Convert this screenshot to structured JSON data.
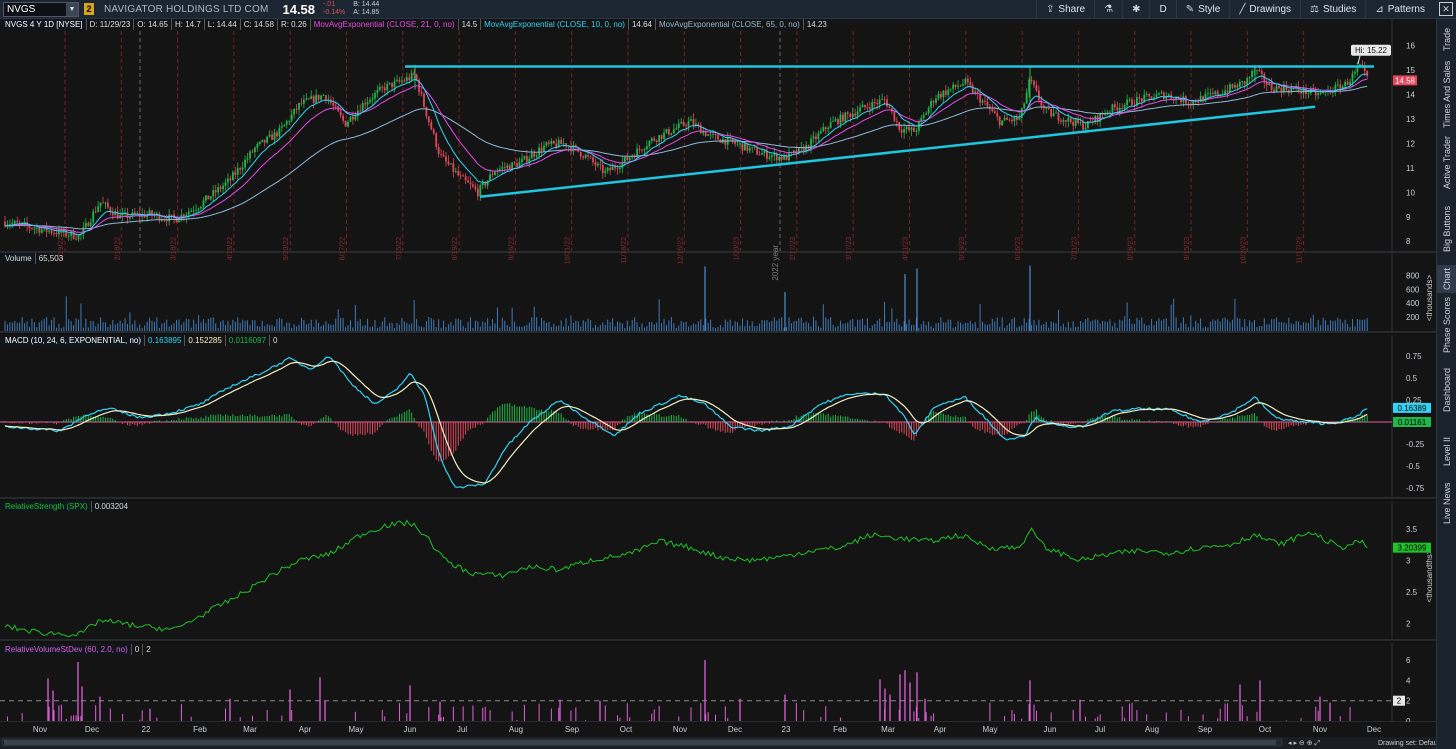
{
  "toolbar": {
    "symbol": "NVGS",
    "link_badge": "2",
    "company": "NAVIGATOR HOLDINGS LTD COM",
    "last": "14.58",
    "change": "-.01",
    "change_pct": "-0.14%",
    "bid": "B: 14.44",
    "ask": "A: 14.85",
    "buttons": [
      {
        "label": "Share",
        "icon": "share-icon"
      },
      {
        "label": "",
        "icon": "flask-icon"
      },
      {
        "label": "",
        "icon": "gear-icon"
      },
      {
        "label": "D",
        "icon": ""
      },
      {
        "label": "Style",
        "icon": "pen-icon"
      },
      {
        "label": "Drawings",
        "icon": "drawing-icon"
      },
      {
        "label": "Studies",
        "icon": "studies-icon"
      },
      {
        "label": "Patterns",
        "icon": "patterns-icon"
      }
    ]
  },
  "side_tabs": [
    "Trade",
    "Times And Sales",
    "Active Trader",
    "Big Buttons",
    "Chart",
    "Phase Scores",
    "Dashboard",
    "Level II",
    "Live News"
  ],
  "price_panel": {
    "header": [
      "NVGS 4 Y 1D [NYSE]",
      "D: 11/29/23",
      "O: 14.65",
      "H: 14.7",
      "L: 14.44",
      "C: 14.58",
      "R: 0.26"
    ],
    "studies": [
      {
        "label": "MovAvgExponential (CLOSE, 21, 0, no)",
        "value": "14.5",
        "color": "#e34de8"
      },
      {
        "label": "MovAvgExponential (CLOSE, 10, 0, no)",
        "value": "14.64",
        "color": "#31d4f5"
      },
      {
        "label": "MovAvgExponential (CLOSE, 65, 0, no)",
        "value": "14.23",
        "color": "#8fb8d8"
      }
    ],
    "hi_label": "Hi: 15.22",
    "last_label": "14.58",
    "y_ticks": [
      "16",
      "15",
      "14",
      "13",
      "12",
      "11",
      "10",
      "9",
      "8"
    ],
    "date_labels": [
      "1/19/22",
      "2/18/22",
      "3/18/22",
      "4/15/22",
      "5/20/22",
      "6/17/22",
      "7/15/22",
      "8/19/22",
      "9/16/22",
      "10/21/22",
      "11/18/22",
      "12/16/22",
      "1/20/23",
      "2/17/23",
      "3/17/23",
      "4/21/23",
      "5/19/23",
      "6/16/23",
      "7/21/23",
      "8/18/23",
      "9/15/23",
      "10/20/23",
      "11/17/23"
    ],
    "year_labels": [
      "2022 year"
    ]
  },
  "volume_panel": {
    "header": [
      "Volume",
      "65,503"
    ],
    "y_ticks": [
      "800",
      "600",
      "400",
      "200"
    ],
    "unit": "<thousands>"
  },
  "macd_panel": {
    "header": [
      "MACD (10, 24, 6, EXPONENTIAL, no)",
      "0.163895",
      "0.152285",
      "0.0116097",
      "0"
    ],
    "y_ticks": [
      "0.75",
      "0.5",
      "0.25",
      "-0.25",
      "-0.5",
      "-0.75"
    ],
    "value_label": "0.16389",
    "diff_label": "0.01161"
  },
  "rs_panel": {
    "header": [
      "RelativeStrength (SPX)",
      "0.003204"
    ],
    "y_ticks": [
      "3.5",
      "3",
      "2.5",
      "2"
    ],
    "value_label": "3.20399",
    "unit": "<thousandths>"
  },
  "rv_panel": {
    "header": [
      "RelativeVolumeStDev (60, 2.0, no)",
      "0",
      "2"
    ],
    "y_ticks": [
      "6",
      "4",
      "2",
      "0"
    ],
    "value_label": "2"
  },
  "x_axis": {
    "labels": [
      "Nov",
      "Dec",
      "22",
      "Feb",
      "Mar",
      "Apr",
      "May",
      "Jun",
      "Jul",
      "Aug",
      "Sep",
      "Oct",
      "Nov",
      "Dec",
      "23",
      "Feb",
      "Mar",
      "Apr",
      "May",
      "Jun",
      "Jul",
      "Aug",
      "Sep",
      "Oct",
      "Nov",
      "Dec"
    ],
    "status": "Drawing set: Default"
  },
  "colors": {
    "accent": "#31d4f5",
    "up": "#1fb84a",
    "down": "#e0475a",
    "trend": "#1fc6e0",
    "rs": "#22c02a",
    "rv": "#e060d8"
  }
}
